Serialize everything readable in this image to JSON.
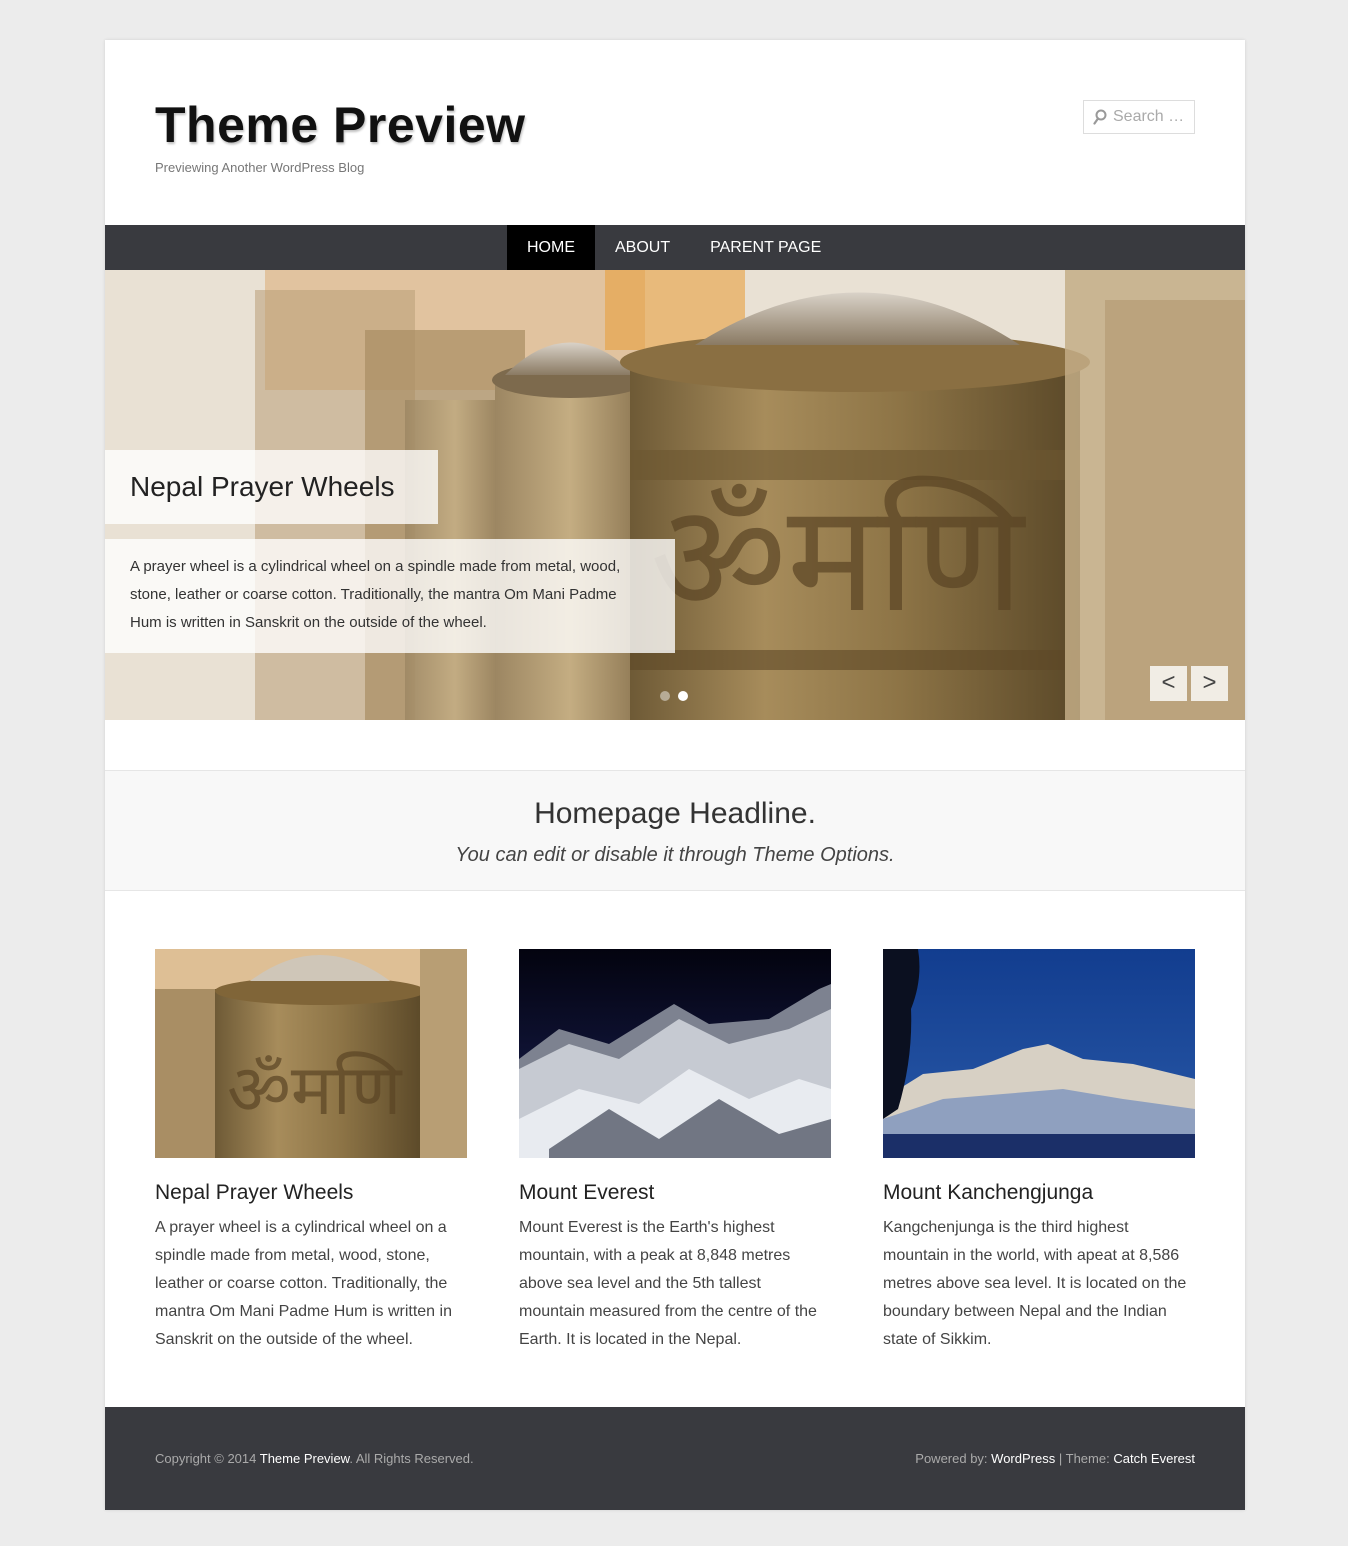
{
  "header": {
    "site_title": "Theme Preview",
    "site_description": "Previewing Another WordPress Blog",
    "search_placeholder": "Search …"
  },
  "nav": {
    "items": [
      {
        "label": "HOME",
        "active": true
      },
      {
        "label": "ABOUT",
        "active": false
      },
      {
        "label": "PARENT PAGE",
        "active": false
      }
    ]
  },
  "slider": {
    "title": "Nepal Prayer Wheels",
    "excerpt": "A prayer wheel is a cylindrical wheel on a spindle made from metal, wood, stone, leather or coarse cotton. Traditionally, the mantra Om Mani Padme Hum is written in Sanskrit on the outside of the wheel.",
    "prev_label": "<",
    "next_label": ">",
    "slide_count": 2,
    "current_slide": 2
  },
  "headline": {
    "title": "Homepage Headline.",
    "subtitle": "You can edit or disable it through Theme Options."
  },
  "features": [
    {
      "title": "Nepal Prayer Wheels",
      "text": "A prayer wheel is a cylindrical wheel on a spindle made from metal, wood, stone, leather or coarse cotton. Traditionally, the mantra Om Mani Padme Hum is written in Sanskrit on the outside of the wheel."
    },
    {
      "title": "Mount Everest",
      "text": "Mount Everest is the Earth's highest mountain, with a peak at 8,848 metres above sea level and the 5th tallest mountain measured from the centre of the Earth. It is located in the Nepal."
    },
    {
      "title": "Mount Kanchengjunga",
      "text": "Kangchenjunga is the third highest mountain in the world, with apeat at 8,586 metres above sea level. It is located on the boundary between Nepal and the Indian state of Sikkim."
    }
  ],
  "footer": {
    "copyright_prefix": "Copyright © 2014",
    "copyright_link": "Theme Preview",
    "copyright_suffix": ". All Rights Reserved.",
    "powered_prefix": "Powered by:",
    "powered_link": "WordPress",
    "separator": "|",
    "theme_prefix": "Theme:",
    "theme_link": "Catch Everest"
  },
  "colors": {
    "nav_background": "#393a3f",
    "nav_active": "#000000",
    "footer_background": "#393a3f",
    "page_background": "#ececec"
  },
  "icons": {
    "search": "search-icon"
  }
}
